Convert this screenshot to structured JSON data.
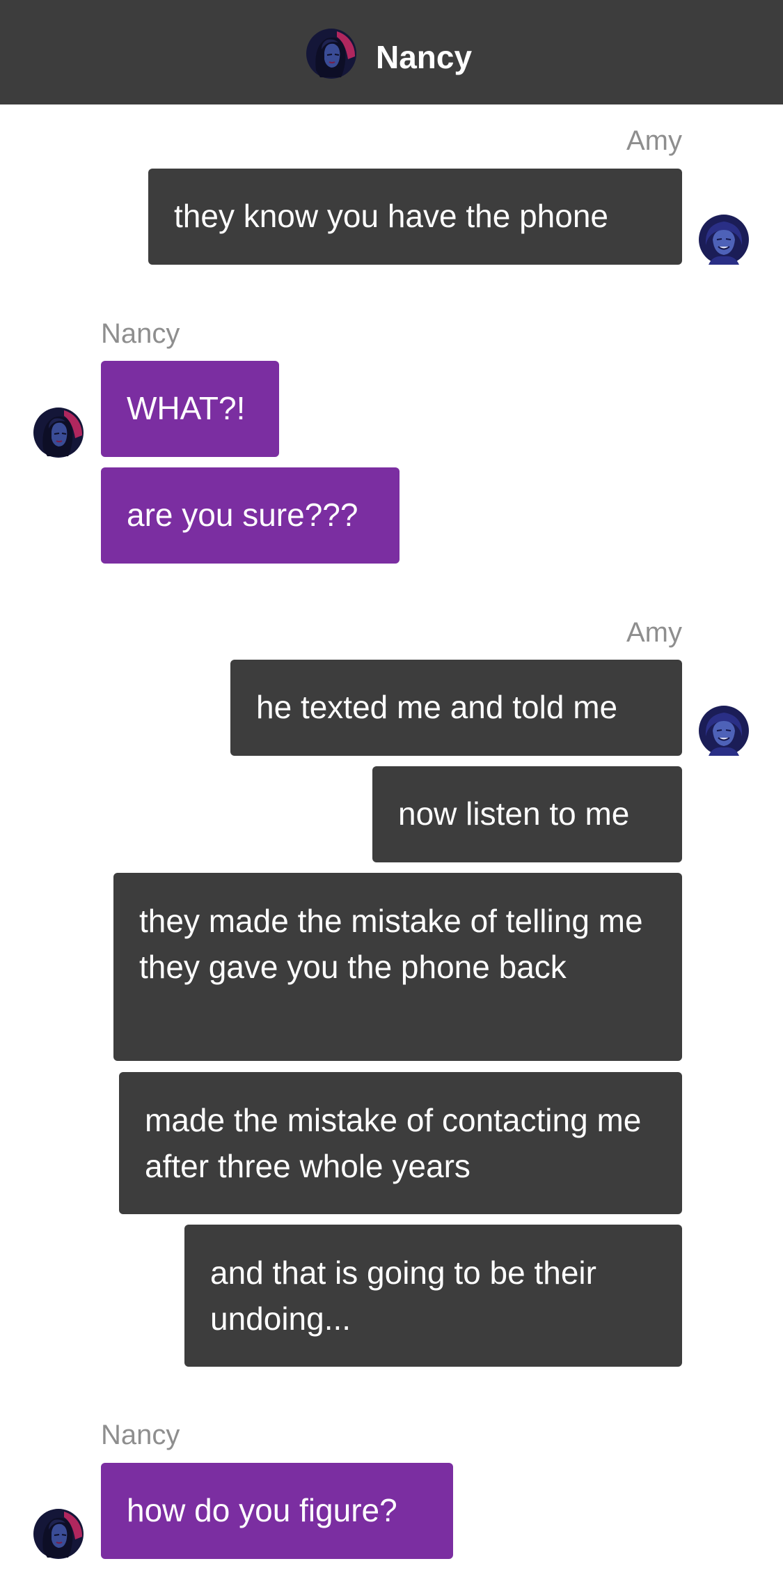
{
  "header": {
    "title": "Nancy",
    "avatar_icon": "nancy-avatar-icon"
  },
  "colors": {
    "header_bg": "#3d3d3d",
    "outgoing_bubble": "#3d3d3d",
    "incoming_bubble": "#7b2ea1",
    "sender_label": "#8e8e8e",
    "background": "#ffffff"
  },
  "messages": [
    {
      "sender": "Amy",
      "side": "right",
      "avatar_icon": "amy-avatar-icon",
      "bubbles": [
        "they know you have the phone"
      ]
    },
    {
      "sender": "Nancy",
      "side": "left",
      "avatar_icon": "nancy-avatar-icon",
      "bubbles": [
        "WHAT?!",
        "are you sure???"
      ]
    },
    {
      "sender": "Amy",
      "side": "right",
      "avatar_icon": "amy-avatar-icon",
      "bubbles": [
        "he texted me and told me",
        "now listen to me",
        "they made the mistake of telling me they gave you the phone back",
        "made the mistake of contacting me after three whole years",
        "and that is going to be their undoing..."
      ]
    },
    {
      "sender": "Nancy",
      "side": "left",
      "avatar_icon": "nancy-avatar-icon",
      "bubbles": [
        "how do you figure?"
      ]
    }
  ]
}
